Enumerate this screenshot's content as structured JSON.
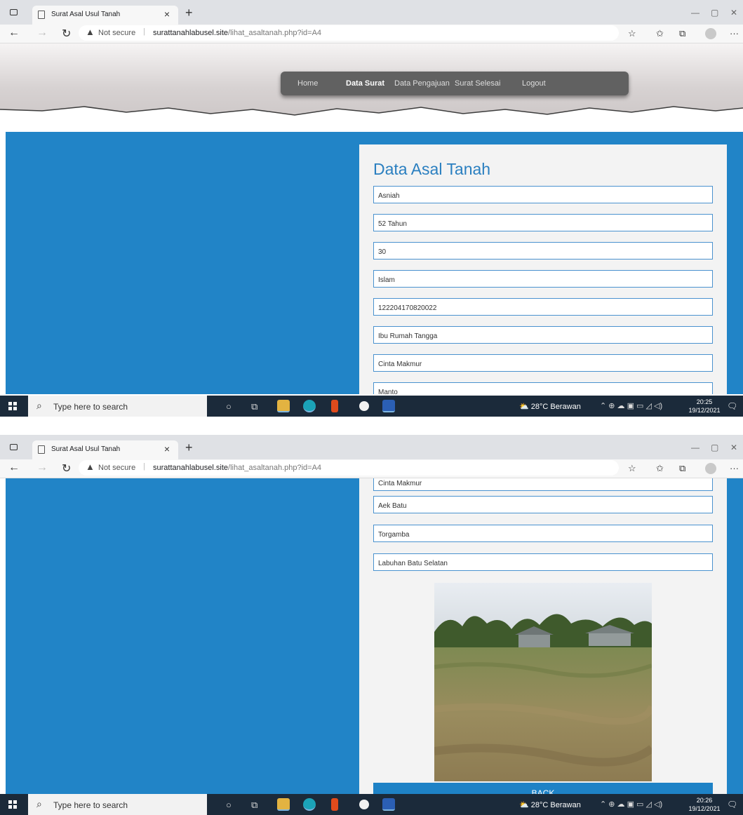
{
  "browser": {
    "tab_title": "Surat Asal Usul Tanah",
    "tab_close": "×",
    "new_tab": "+",
    "not_secure": "Not secure",
    "url_domain": "surattanahlabusel.site",
    "url_path": "/lihat_asaltanah.php?id=A4"
  },
  "nav_menu": {
    "items": [
      "Home",
      "Data Surat",
      "Data Pengajuan",
      "Surat Selesai",
      "Logout"
    ],
    "active": "Data Surat"
  },
  "form": {
    "heading": "Data Asal Tanah",
    "fields": [
      "Asniah",
      "52 Tahun",
      "30",
      "Islam",
      "122204170820022",
      "Ibu Rumah Tangga",
      "Cinta Makmur",
      "Manto",
      "Aek Batu",
      "Torgamba",
      "Labuhan Batu Selatan"
    ],
    "back_button": "BACK"
  },
  "taskbar": {
    "search_placeholder": "Type here to search",
    "weather": "28°C  Berawan",
    "time_1": "20:25",
    "date_1": "19/12/2021",
    "time_2": "20:26",
    "date_2": "19/12/2021",
    "notification_count": "2"
  },
  "colors": {
    "page_blue": "#2184c7",
    "heading_blue": "#2a7fc0",
    "menu_bg": "#616161",
    "taskbar": "#1b2a3a"
  }
}
